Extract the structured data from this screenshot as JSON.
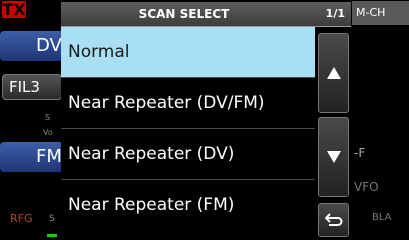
{
  "background": {
    "tx_badge": "TX",
    "mch_label": "M-CH",
    "dv_label": "DV",
    "fil_label": "FIL3",
    "s_small": "S",
    "vo_small": "Vo",
    "fm_label": "FM",
    "rfg_label": "RFG",
    "rfg_s": "S",
    "right_f": "-F",
    "right_vfo": "VFO",
    "right_bla": "BLA"
  },
  "dialog": {
    "title": "SCAN SELECT",
    "page": "1/1",
    "items": [
      {
        "label": "Normal",
        "selected": true
      },
      {
        "label": "Near Repeater (DV/FM)",
        "selected": false
      },
      {
        "label": "Near Repeater (DV)",
        "selected": false
      },
      {
        "label": "Near Repeater (FM)",
        "selected": false
      }
    ],
    "controls": {
      "up": "arrow-up-icon",
      "down": "arrow-down-icon",
      "back": "return-icon"
    }
  },
  "colors": {
    "selected_bg": "#a8dff2",
    "tx_red": "#cc0000",
    "blue_button": "#2d4a94"
  }
}
